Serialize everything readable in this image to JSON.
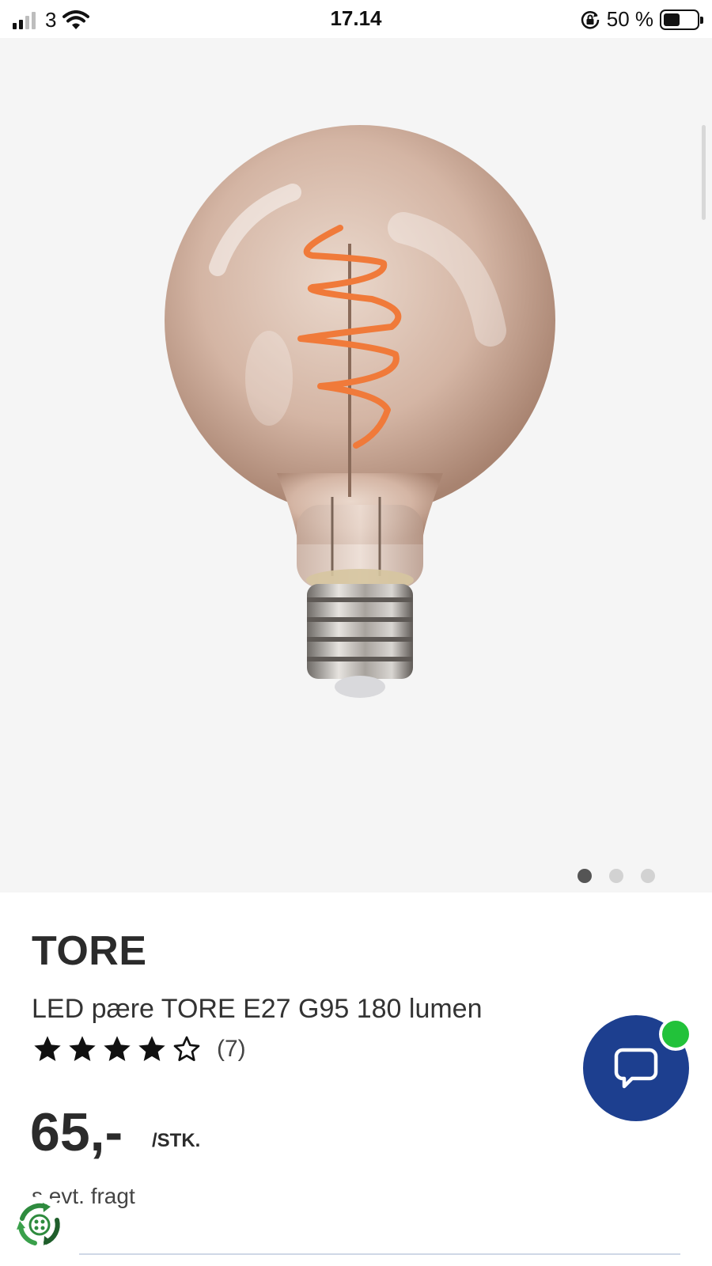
{
  "status_bar": {
    "carrier": "3",
    "time": "17.14",
    "battery": "50 %",
    "battery_level": 0.5,
    "icons": [
      "signal-icon",
      "wifi-icon",
      "rotation-lock-icon",
      "battery-icon"
    ]
  },
  "gallery": {
    "image": "light-bulb-image",
    "slide_count": 3,
    "active_slide": 1
  },
  "product": {
    "brand": "TORE",
    "name": "LED pære TORE E27 G95 180 lumen",
    "rating": 4,
    "rating_max": 5,
    "review_count": "(7)",
    "price": "65,-",
    "unit": "/STK.",
    "shipping_note": "s evt. fragt"
  },
  "chat": {
    "icon": "chat-icon",
    "status_color": "#22c23a",
    "button_color": "#1d3f8f"
  },
  "eco_badge": {
    "icon": "recycle-badge-icon"
  }
}
